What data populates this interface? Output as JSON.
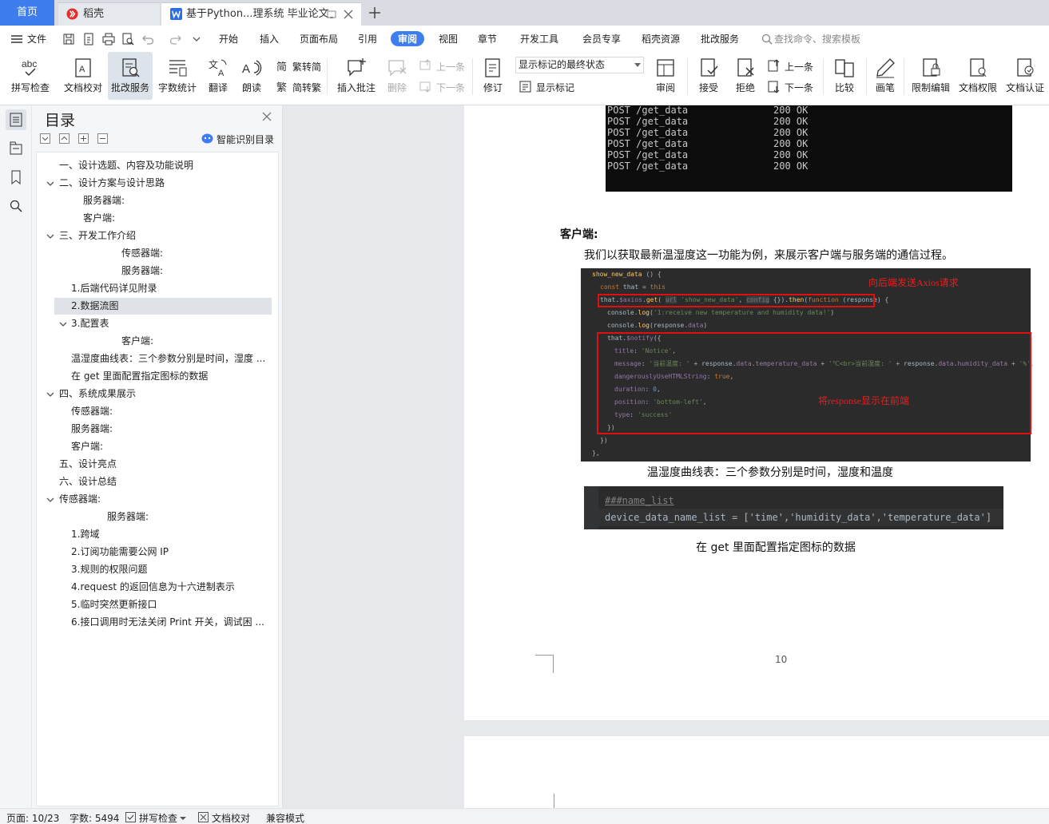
{
  "tabs": {
    "home": "首页",
    "daoke": "稻壳",
    "doc": "基于Python...理系统 毕业论文"
  },
  "menu": {
    "file": "文件",
    "items": [
      "开始",
      "插入",
      "页面布局",
      "引用",
      "审阅",
      "视图",
      "章节",
      "开发工具",
      "会员专享",
      "稻壳资源",
      "批改服务"
    ],
    "active": "审阅",
    "search": "查找命令、搜索模板"
  },
  "toolbar": {
    "spellcheck": "拼写检查",
    "doccheck": "文档校对",
    "correction": "批改服务",
    "wordcount": "字数统计",
    "translate": "翻译",
    "read": "朗读",
    "trad": "繁转简",
    "simp": "简转繁",
    "insert_comment": "插入批注",
    "delete": "删除",
    "prev": "上一条",
    "next": "下一条",
    "track": "修订",
    "mark_state": "显示标记的最终状态",
    "show_marks": "显示标记",
    "review": "审阅",
    "accept": "接受",
    "reject": "拒绝",
    "prev2": "上一条",
    "next2": "下一条",
    "compare": "比较",
    "pen": "画笔",
    "restrict": "限制编辑",
    "doc_rights": "文档权限",
    "doc_cert": "文档认证"
  },
  "nav": {
    "title": "目录",
    "smart": "智能识别目录",
    "items": [
      {
        "text": "一、设计选题、内容及功能说明",
        "indent": 0,
        "toggle": "none"
      },
      {
        "text": "二、设计方案与设计思路",
        "indent": 0,
        "toggle": "open"
      },
      {
        "text": "服务器端:",
        "indent": 2,
        "toggle": "none"
      },
      {
        "text": "客户端:",
        "indent": 2,
        "toggle": "none"
      },
      {
        "text": "三、开发工作介绍",
        "indent": 0,
        "toggle": "open"
      },
      {
        "text": "传感器端:",
        "indent": 5,
        "toggle": "none"
      },
      {
        "text": "服务器端:",
        "indent": 5,
        "toggle": "none"
      },
      {
        "text": "1.后端代码详见附录",
        "indent": 1,
        "toggle": "none"
      },
      {
        "text": "2.数据流图",
        "indent": 1,
        "toggle": "none",
        "selected": true
      },
      {
        "text": "3.配置表",
        "indent": 1,
        "toggle": "open"
      },
      {
        "text": "客户端:",
        "indent": 5,
        "toggle": "none"
      },
      {
        "text": "温湿度曲线表：三个参数分别是时间，湿度 ...",
        "indent": 1,
        "toggle": "none"
      },
      {
        "text": "在 get 里面配置指定图标的数据",
        "indent": 1,
        "toggle": "none"
      },
      {
        "text": "四、系统成果展示",
        "indent": 0,
        "toggle": "open"
      },
      {
        "text": "传感器端:",
        "indent": 1,
        "toggle": "none"
      },
      {
        "text": "服务器端:",
        "indent": 1,
        "toggle": "none"
      },
      {
        "text": "客户端:",
        "indent": 1,
        "toggle": "none"
      },
      {
        "text": "五、设计亮点",
        "indent": 0,
        "toggle": "none"
      },
      {
        "text": "六、设计总结",
        "indent": 0,
        "toggle": "none"
      },
      {
        "text": "传感器端:",
        "indent": 0,
        "toggle": "open"
      },
      {
        "text": "服务器端:",
        "indent": 4,
        "toggle": "none"
      },
      {
        "text": "1.跨域",
        "indent": 1,
        "toggle": "none"
      },
      {
        "text": "2.订阅功能需要公网 IP",
        "indent": 1,
        "toggle": "none"
      },
      {
        "text": "3.规则的权限问题",
        "indent": 1,
        "toggle": "none"
      },
      {
        "text": "4.request 的返回信息为十六进制表示",
        "indent": 1,
        "toggle": "none"
      },
      {
        "text": "5.临时突然更新接口",
        "indent": 1,
        "toggle": "none"
      },
      {
        "text": "6.接口调用时无法关闭 Print 开关，调试困 ...",
        "indent": 1,
        "toggle": "none"
      }
    ]
  },
  "doc": {
    "terminal_lines": [
      {
        "req": "POST /get_data",
        "status": "200 OK"
      },
      {
        "req": "POST /get_data",
        "status": "200 OK"
      },
      {
        "req": "POST /get_data",
        "status": "200 OK"
      },
      {
        "req": "POST /get_data",
        "status": "200 OK"
      },
      {
        "req": "POST /get_data",
        "status": "200 OK"
      },
      {
        "req": "POST /get_data",
        "status": "200 OK"
      }
    ],
    "client_heading": "客户端:",
    "paragraph": "我们以获取最新温湿度这一功能为例，来展示客户端与服务端的通信过程。",
    "annotation1": "向后端发送Axios请求",
    "annotation2": "将response显示在前端",
    "caption1": "温湿度曲线表：三个参数分别是时间，湿度和温度",
    "code2_comment": "###name_list",
    "code2_line": "device_data_name_list = ['time','humidity_data','temperature_data']",
    "caption2": "在 get 里面配置指定图标的数据",
    "page_number": "10"
  },
  "status": {
    "page": "页面: 10/23",
    "words": "字数: 5494",
    "spell": "拼写检查",
    "proof": "文档校对",
    "compat": "兼容模式"
  }
}
